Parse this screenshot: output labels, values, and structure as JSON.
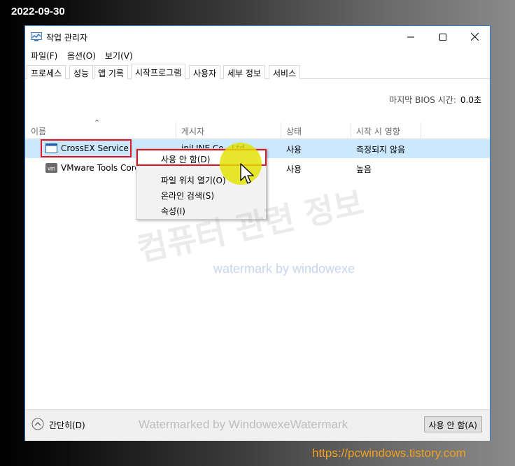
{
  "overlay": {
    "date": "2022-09-30",
    "url": "https://pcwindows.tistory.com",
    "watermark_korean": "컴퓨터 관련 정보",
    "watermark_english": "watermark by windowexe",
    "watermark_footer": "Watermarked by WindowexeWatermark"
  },
  "window": {
    "title": "작업 관리자",
    "app_icon": "task-manager-icon",
    "controls": [
      "minimize-icon",
      "maximize-icon",
      "close-icon"
    ]
  },
  "menu": {
    "items": [
      "파일(F)",
      "옵션(O)",
      "보기(V)"
    ]
  },
  "tabs": {
    "items": [
      "프로세스",
      "성능",
      "앱 기록",
      "시작프로그램",
      "사용자",
      "세부 정보",
      "서비스"
    ],
    "active": "시작프로그램"
  },
  "bios": {
    "label": "마지막 BIOS 시간:",
    "value": "0.0초"
  },
  "table": {
    "columns": [
      "이름",
      "게시자",
      "상태",
      "시작 시 영향"
    ],
    "rows": [
      {
        "name": "CrossEX Service",
        "publisher": "iniLINE Co., Ltd.",
        "status": "사용",
        "impact": "측정되지 않음",
        "icon": "window-icon",
        "selected": true
      },
      {
        "name": "VMware Tools Core",
        "publisher": "",
        "status": "사용",
        "impact": "높음",
        "icon": "vmware-icon",
        "selected": false
      }
    ]
  },
  "context_menu": {
    "items": [
      "사용 안 함(D)",
      "파일 위치 열기(O)",
      "온라인 검색(S)",
      "속성(I)"
    ]
  },
  "footer": {
    "collapse_label": "간단히(D)",
    "disable_button": "사용 안 함(A)"
  },
  "colors": {
    "selection": "#cce8ff",
    "highlight_box": "#e0141e",
    "cursor_halo": "#e2e200",
    "url": "#f0a020",
    "window_border": "#2b79c2"
  }
}
